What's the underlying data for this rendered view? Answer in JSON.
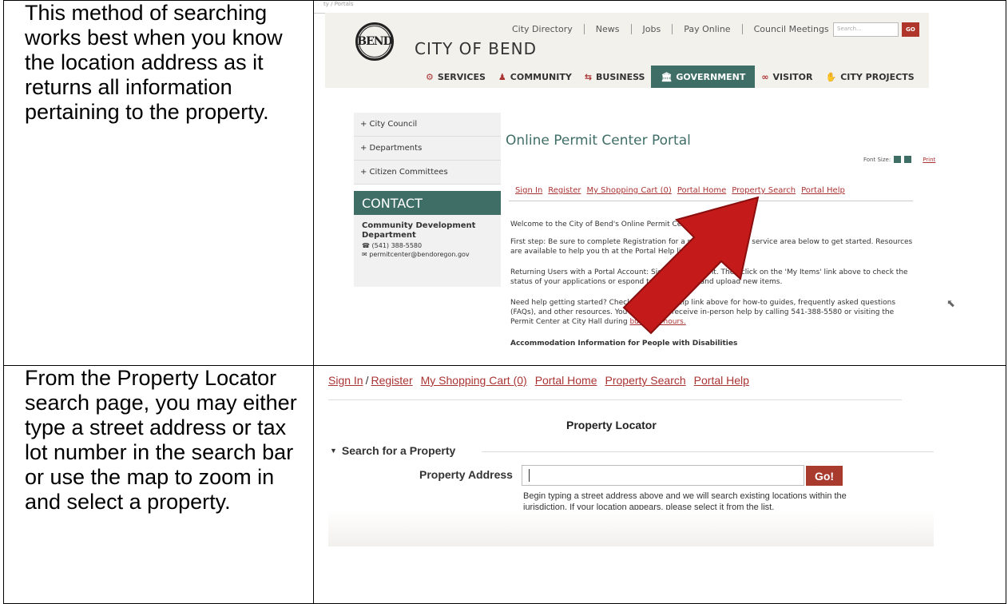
{
  "row1": {
    "description": "This method of searching works best when you know the location address as it returns all information pertaining to the property.",
    "site": {
      "url_fragment": "ty / Portals",
      "logo_text": "BEND",
      "city_name": "CITY OF BEND",
      "top_links": [
        "City Directory",
        "News",
        "Jobs",
        "Pay Online",
        "Council Meetings"
      ],
      "search_placeholder": "Search...",
      "search_go": "GO",
      "main_nav": [
        "SERVICES",
        "COMMUNITY",
        "BUSINESS",
        "GOVERNMENT",
        "VISITOR",
        "CITY PROJECTS"
      ],
      "side_nav": [
        "+ City Council",
        "+ Departments",
        "+ Citizen Committees"
      ],
      "contact_heading": "CONTACT",
      "contact_dept": "Community Development Department",
      "contact_phone": "(541) 388-5580",
      "contact_email": "permitcenter@bendoregon.gov",
      "portal_title": "Online Permit Center Portal",
      "font_size_label": "Font Size:",
      "print_label": "Print",
      "portal_links": [
        "Sign In",
        "Register",
        "My Shopping Cart (0)",
        "Portal Home",
        "Property Search",
        "Portal Help"
      ],
      "paragraphs": [
        "Welcome to the City of Bend's Online Permit Ce",
        "First step: Be sure to complete Registration for a                         nd then choose a service area below to get started. Resources are available to help you th                          at the Portal Help link above.",
        "Returning Users with a Portal Account: Sig                          Portal Account. Then click on the 'My Items' link above to check the status of your applications or                          espond to corrections, and upload new items.",
        "Need help getting started? Check out our Po          Help link above for how-to guides, frequently asked questions (FAQs), and other resources. You can always receive in-person help by calling 541-388-5580 or visiting the Permit Center at City Hall during",
        "Accommodation Information for People with Disabilities"
      ],
      "business_hours_link": "business hours."
    }
  },
  "row2": {
    "description": "From the Property Locator search page, you may either type a street address or tax lot number in the search bar or use the map to zoom in and select a property.",
    "portal_links": [
      "Sign In",
      "/",
      "Register",
      "My Shopping Cart (0)",
      "Portal Home",
      "Property Search",
      "Portal Help"
    ],
    "page_title": "Property Locator",
    "section_heading": "Search for a Property",
    "field_label": "Property Address",
    "go_label": "Go!",
    "help_text": "Begin typing a street address above and we will search existing locations within the jurisdiction. If your location appears, please select it from the list."
  },
  "colors": {
    "teal": "#3f6e67",
    "red_link": "#a33333",
    "go_red": "#a83a2e",
    "arrow_red": "#c41a1a"
  }
}
